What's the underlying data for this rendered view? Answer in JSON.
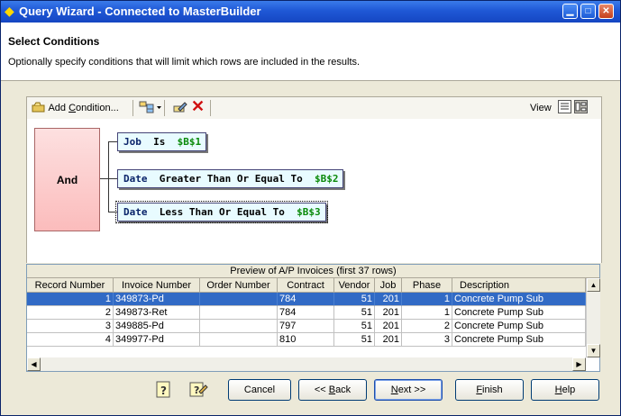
{
  "window": {
    "title": "Query Wizard - Connected to MasterBuilder"
  },
  "header": {
    "title": "Select Conditions",
    "description": "Optionally specify conditions that will limit which rows are included in the results."
  },
  "toolbar": {
    "add_condition_prefix": "Add ",
    "add_condition_u": "C",
    "add_condition_suffix": "ondition...",
    "view_label": "View"
  },
  "diagram": {
    "group_operator": "And",
    "conditions": [
      {
        "field": "Job",
        "operator": "Is",
        "value": "$B$1"
      },
      {
        "field": "Date",
        "operator": "Greater Than Or Equal To",
        "value": "$B$2"
      },
      {
        "field": "Date",
        "operator": "Less Than Or Equal To",
        "value": "$B$3"
      }
    ]
  },
  "preview": {
    "title": "Preview of A/P Invoices (first 37 rows)",
    "columns": [
      "Record Number",
      "Invoice Number",
      "Order Number",
      "Contract",
      "Vendor",
      "Job",
      "Phase",
      "Description"
    ],
    "rows": [
      [
        "1",
        "349873-Pd",
        "",
        "784",
        "51",
        "201",
        "1",
        "Concrete Pump Sub"
      ],
      [
        "2",
        "349873-Ret",
        "",
        "784",
        "51",
        "201",
        "1",
        "Concrete Pump Sub"
      ],
      [
        "3",
        "349885-Pd",
        "",
        "797",
        "51",
        "201",
        "2",
        "Concrete Pump Sub"
      ],
      [
        "4",
        "349977-Pd",
        "",
        "810",
        "51",
        "201",
        "3",
        "Concrete Pump Sub"
      ]
    ]
  },
  "footer": {
    "cancel": "Cancel",
    "back_prefix": "<< ",
    "back_u": "B",
    "back_suffix": "ack",
    "next_u": "N",
    "next_suffix": "ext >>",
    "finish_u": "F",
    "finish_suffix": "inish",
    "help_u": "H",
    "help_suffix": "elp"
  },
  "colors": {
    "title_bar": "#1f58d6",
    "selected_row": "#316ac5",
    "condition_value": "#0a8a0a",
    "and_box": "#fbbcbc"
  }
}
